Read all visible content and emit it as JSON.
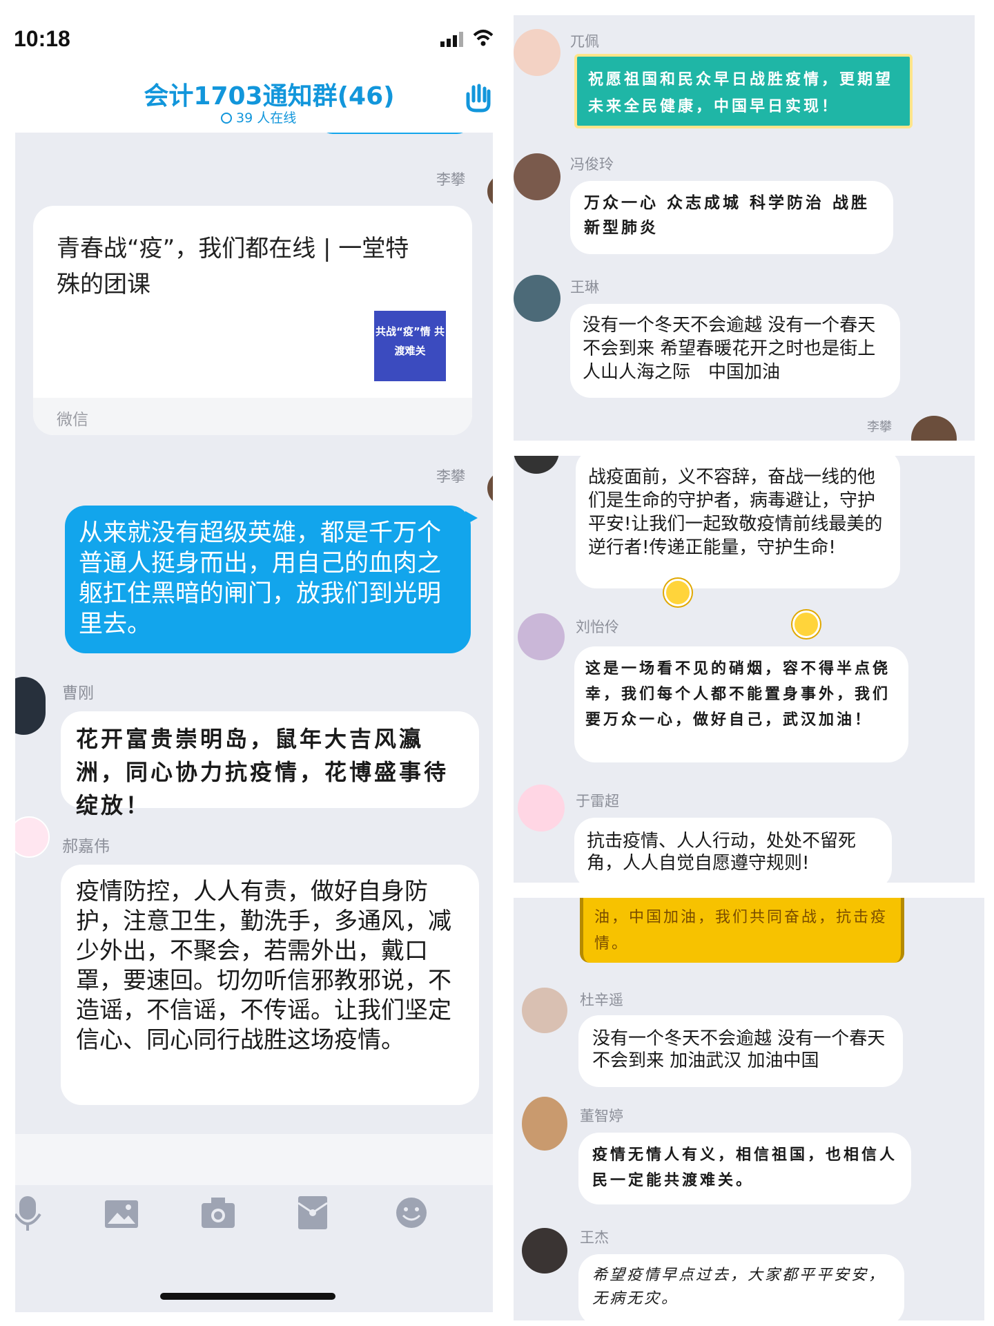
{
  "status_bar": {
    "time": "10:18"
  },
  "header": {
    "title": "会计1703通知群(46)",
    "online": "39 人在线"
  },
  "left_chat": {
    "msg1": {
      "sender": "李攀",
      "card_title": "青春战“疫”，我们都在线 | 一堂特殊的团课",
      "thumb_text": "共战“疫”情 共渡难关",
      "source": "微信"
    },
    "msg2": {
      "sender": "李攀",
      "text": "从来就没有超级英雄，都是千万个普通人挺身而出，用自己的血肉之躯扛住黑暗的闸门，放我们到光明里去。"
    },
    "msg3": {
      "sender": "曹刚",
      "text": "花开富贵崇明岛，鼠年大吉风瀛洲，同心协力抗疫情，花博盛事待绽放！"
    },
    "msg4": {
      "sender": "郝嘉伟",
      "text": "疫情防控，人人有责，做好自身防护，注意卫生，勤洗手，多通风，减少外出，不聚会，若需外出，戴口罩，要速回。切勿听信邪教邪说，不造谣，不信谣，不传谣。让我们坚定信心、同心同行战胜这场疫情。"
    }
  },
  "toolbar": {
    "icons": [
      "microphone-icon",
      "image-icon",
      "camera-icon",
      "red-packet-icon",
      "emoji-icon"
    ]
  },
  "right_top": {
    "msg1": {
      "sender": "兀佩",
      "text": "祝愿祖国和民众早日战胜疫情，更期望未来全民健康，中国早日实现！"
    },
    "msg2": {
      "sender": "冯俊玲",
      "text": "万众一心 众志成城 科学防治 战胜新型肺炎"
    },
    "msg3": {
      "sender": "王琳",
      "text": "没有一个冬天不会逾越 没有一个春天不会到来 希望春暖花开之时也是街上人山人海之际　中国加油"
    },
    "self_sender": "李攀"
  },
  "right_mid": {
    "msg1": {
      "text": "战疫面前，义不容辞，奋战一线的他们是生命的守护者，病毒避让，守护平安!让我们一起致敬疫情前线最美的逆行者!传递正能量，守护生命!"
    },
    "msg2": {
      "sender": "刘怡伶",
      "text": "这是一场看不见的硝烟，容不得半点侥幸，我们每个人都不能置身事外，我们要万众一心，做好自己，武汉加油！"
    },
    "msg3": {
      "sender": "于雷超",
      "text": "抗击疫情、人人行动，处处不留死角，人人自觉自愿遵守规则!"
    }
  },
  "right_bottom": {
    "msg0": {
      "text": "油，中国加油，我们共同奋战，抗击疫情。"
    },
    "msg1": {
      "sender": "杜辛遥",
      "text": "没有一个冬天不会逾越 没有一个春天不会到来 加油武汉 加油中国"
    },
    "msg2": {
      "sender": "董智婷",
      "text": "疫情无情人有义，相信祖国，也相信人民一定能共渡难关。"
    },
    "msg3": {
      "sender": "王杰",
      "text": "希望疫情早点过去，大家都平平安安，无病无灾。"
    }
  },
  "colors": {
    "panel_bg": "#eaecf2",
    "accent_blue": "#1296db",
    "self_bubble": "#12a5ec",
    "title_blue": "#1296db",
    "yellow_bubble": "#f7c200",
    "teal_bubble": "#1fb6a6"
  }
}
